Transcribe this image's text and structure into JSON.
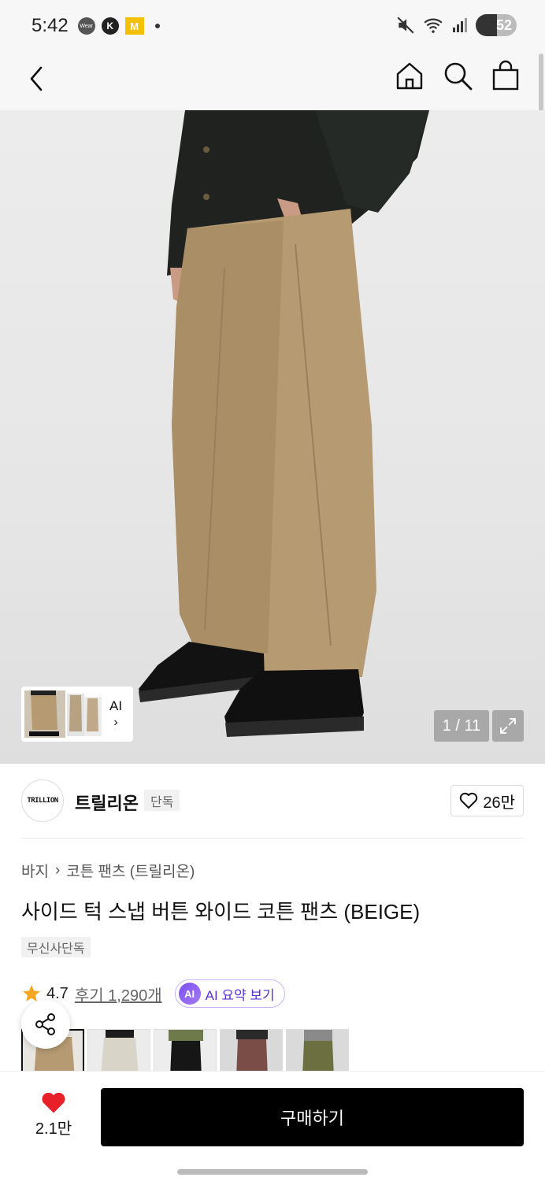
{
  "status_bar": {
    "time": "5:42",
    "wear_label": "Wear",
    "k_label": "K",
    "m_label": "M",
    "battery": "52",
    "battery_level": 0.52
  },
  "header": {
    "icons": [
      "back-arrow-icon",
      "home-icon",
      "search-icon",
      "shopping-bag-icon"
    ]
  },
  "gallery": {
    "ai_label": "AI",
    "ai_chevron": "›",
    "counter": "1 / 11"
  },
  "brand": {
    "logo_text": "TRILLION",
    "name": "트릴리온",
    "tag": "단독",
    "likes": "26만"
  },
  "product": {
    "breadcrumb": [
      "바지",
      "코튼 팬츠 (트릴리온)"
    ],
    "breadcrumb_separator": "›",
    "title": "사이드 턱 스냅 버튼 와이드 코튼 팬츠 (BEIGE)",
    "badge": "무신사단독",
    "rating": "4.7",
    "reviews": "후기 1,290개",
    "ai_badge": "AI",
    "ai_summary": "AI 요약 보기"
  },
  "colors": {
    "accent": "#000000",
    "heart": "#e8202a",
    "star": "#f5a623",
    "ai_purple": "#5b2fd0",
    "pants_beige": "#b59a72"
  },
  "bottom_bar": {
    "wish_count": "2.1만",
    "buy_label": "구매하기"
  }
}
